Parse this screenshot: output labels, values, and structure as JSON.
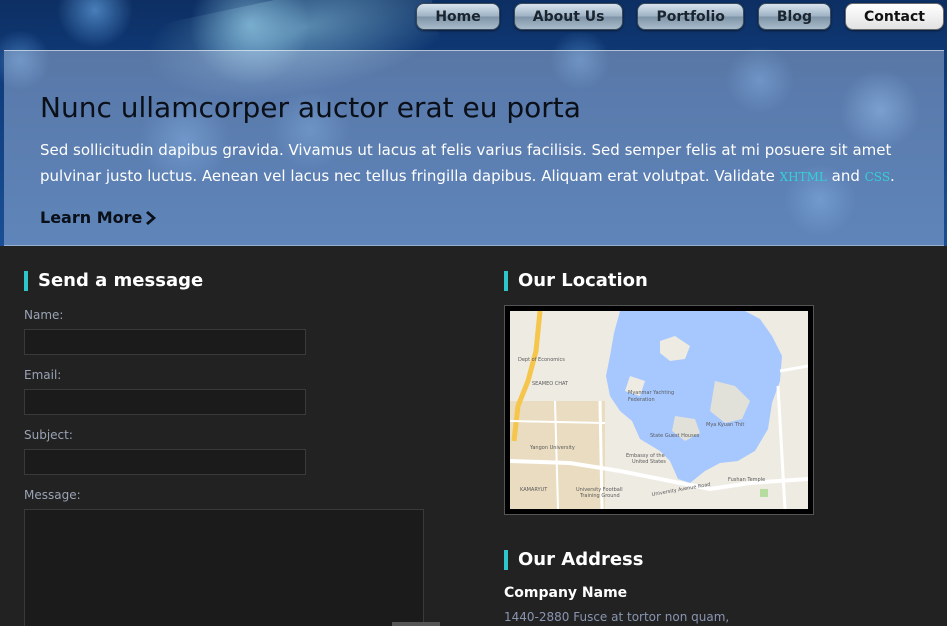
{
  "nav": {
    "items": [
      {
        "label": "Home",
        "active": false
      },
      {
        "label": "About Us",
        "active": false
      },
      {
        "label": "Portfolio",
        "active": false
      },
      {
        "label": "Blog",
        "active": false
      },
      {
        "label": "Contact",
        "active": true
      }
    ]
  },
  "hero": {
    "title": "Nunc ullamcorper auctor erat eu porta",
    "text_before": "Sed sollicitudin dapibus gravida. Vivamus ut lacus at felis varius facilisis. Sed semper felis at mi posuere sit amet pulvinar justo luctus. Aenean vel lacus nec tellus fringilla dapibus. Aliquam erat volutpat. Validate ",
    "link_xhtml": "XHTML",
    "text_and": " and ",
    "link_css": "CSS",
    "text_after": ".",
    "learn_more": "Learn More"
  },
  "contact_form": {
    "heading": "Send a message",
    "name_label": "Name:",
    "email_label": "Email:",
    "subject_label": "Subject:",
    "message_label": "Message:",
    "name_value": "",
    "email_value": "",
    "subject_value": "",
    "message_value": ""
  },
  "location": {
    "heading": "Our Location",
    "map_labels": {
      "dept": "Dept of Economics",
      "seameo": "SEAMEO CHAT",
      "myanmar_yachting": "Myanmar Yachting",
      "federation": "Federation",
      "mya_kyuan": "Mya Kyuan Thit",
      "state_guest": "State Guest Houses",
      "yangon_univ": "Yangon University",
      "embassy": "Embassy of the",
      "embassy2": "United States",
      "kamaryut": "KAMARYUT",
      "univ_football": "University Football",
      "training_ground": "Training Ground",
      "univ_ave": "University Avenue Road",
      "fushan": "Fushan Temple",
      "insein": "Insein Rd",
      "pyay": "Pyay Rd"
    }
  },
  "address": {
    "heading": "Our Address",
    "company_name": "Company Name",
    "line1": "1440-2880 Fusce at tortor non quam,"
  },
  "colors": {
    "accent": "#2ec4c9",
    "background": "#222222",
    "lake": "#a6c8ff"
  }
}
